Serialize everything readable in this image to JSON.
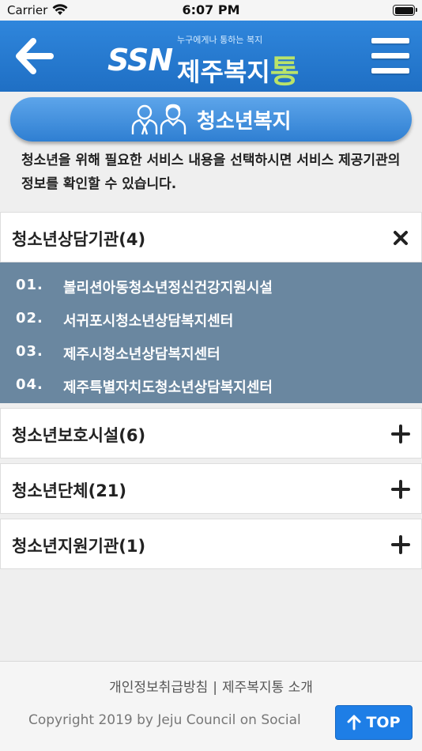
{
  "status_bar": {
    "carrier": "Carrier",
    "time": "6:07 PM"
  },
  "header": {
    "logo_text": "SSN",
    "tagline": "누구에게나 통하는 복지",
    "brand_main": "제주복지",
    "brand_accent": "통",
    "icons": {
      "back": "back-arrow-icon",
      "menu": "hamburger-menu-icon"
    }
  },
  "page": {
    "title": "청소년복지",
    "title_icon": "people-icon",
    "intro": "청소년을 위해 필요한 서비스 내용을 선택하시면 서비스 제공기관의 정보를 확인할 수 있습니다."
  },
  "categories": [
    {
      "label": "청소년상담기관(4)",
      "expanded": true,
      "items": [
        {
          "num": "01.",
          "name": "볼리션아동청소년정신건강지원시설"
        },
        {
          "num": "02.",
          "name": "서귀포시청소년상담복지센터"
        },
        {
          "num": "03.",
          "name": "제주시청소년상담복지센터"
        },
        {
          "num": "04.",
          "name": "제주특별자치도청소년상담복지센터"
        }
      ]
    },
    {
      "label": "청소년보호시설(6)",
      "expanded": false
    },
    {
      "label": "청소년단체(21)",
      "expanded": false
    },
    {
      "label": "청소년지원기관(1)",
      "expanded": false
    }
  ],
  "footer": {
    "privacy_link": "개인정보취급방침",
    "separator": "|",
    "about_link": "제주복지통 소개",
    "copyright": "Copyright 2019 by Jeju Council on Social",
    "top_button": "TOP"
  },
  "colors": {
    "header_blue": "#1f6fc4",
    "list_bg": "#6a87a0",
    "accent_green": "#b9e36a",
    "top_button": "#1e7ee6"
  }
}
